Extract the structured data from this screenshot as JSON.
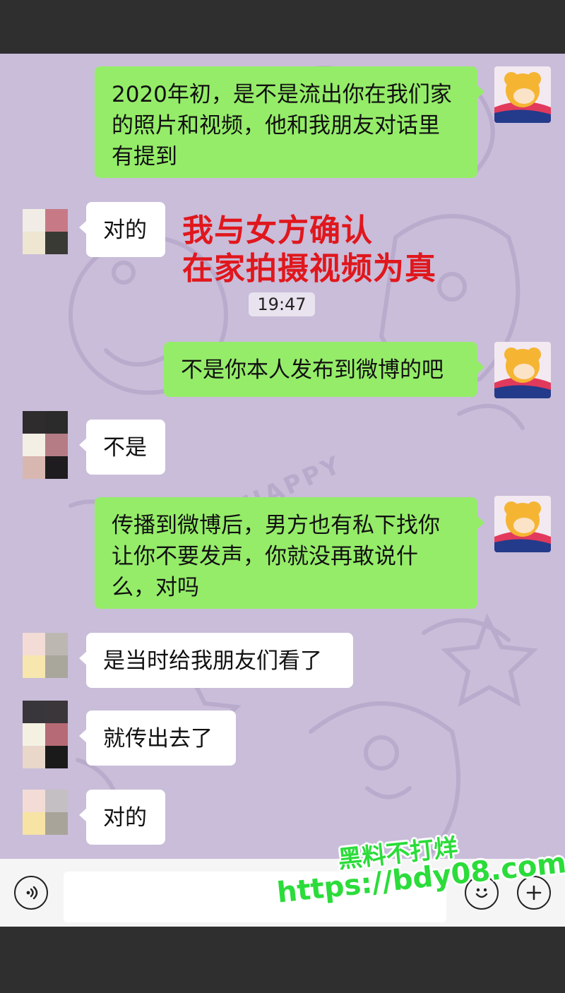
{
  "colors": {
    "chat_background": "#c9bdd9",
    "outgoing_bubble": "#95ec69",
    "incoming_bubble": "#ffffff",
    "annotation_red": "#e0171d",
    "watermark_green": "#2bdc3a"
  },
  "messages": [
    {
      "side": "outgoing",
      "text": "2020年初，是不是流出你在我们家的照片和视频，他和我朋友对话里有提到"
    },
    {
      "side": "incoming",
      "text": "对的"
    },
    {
      "side": "outgoing",
      "text": "不是你本人发布到微博的吧"
    },
    {
      "side": "incoming",
      "text": "不是"
    },
    {
      "side": "outgoing",
      "text": "传播到微博后，男方也有私下找你让你不要发声，你就没再敢说什么，对吗"
    },
    {
      "side": "incoming",
      "text": "是当时给我朋友们看了"
    },
    {
      "side": "incoming",
      "text": "就传出去了"
    },
    {
      "side": "incoming",
      "text": "对的"
    }
  ],
  "timestamp": "19:47",
  "annotation": {
    "line1": "我与女方确认",
    "line2": "在家拍摄视频为真"
  },
  "background_text": "HAPPY",
  "input_bar": {
    "voice_icon": "voice-icon",
    "emoji_icon": "emoji-icon",
    "plus_icon": "plus-icon",
    "input_value": ""
  },
  "watermark": {
    "line1": "黑料不打烊",
    "line2": "https://bdy08.com"
  }
}
